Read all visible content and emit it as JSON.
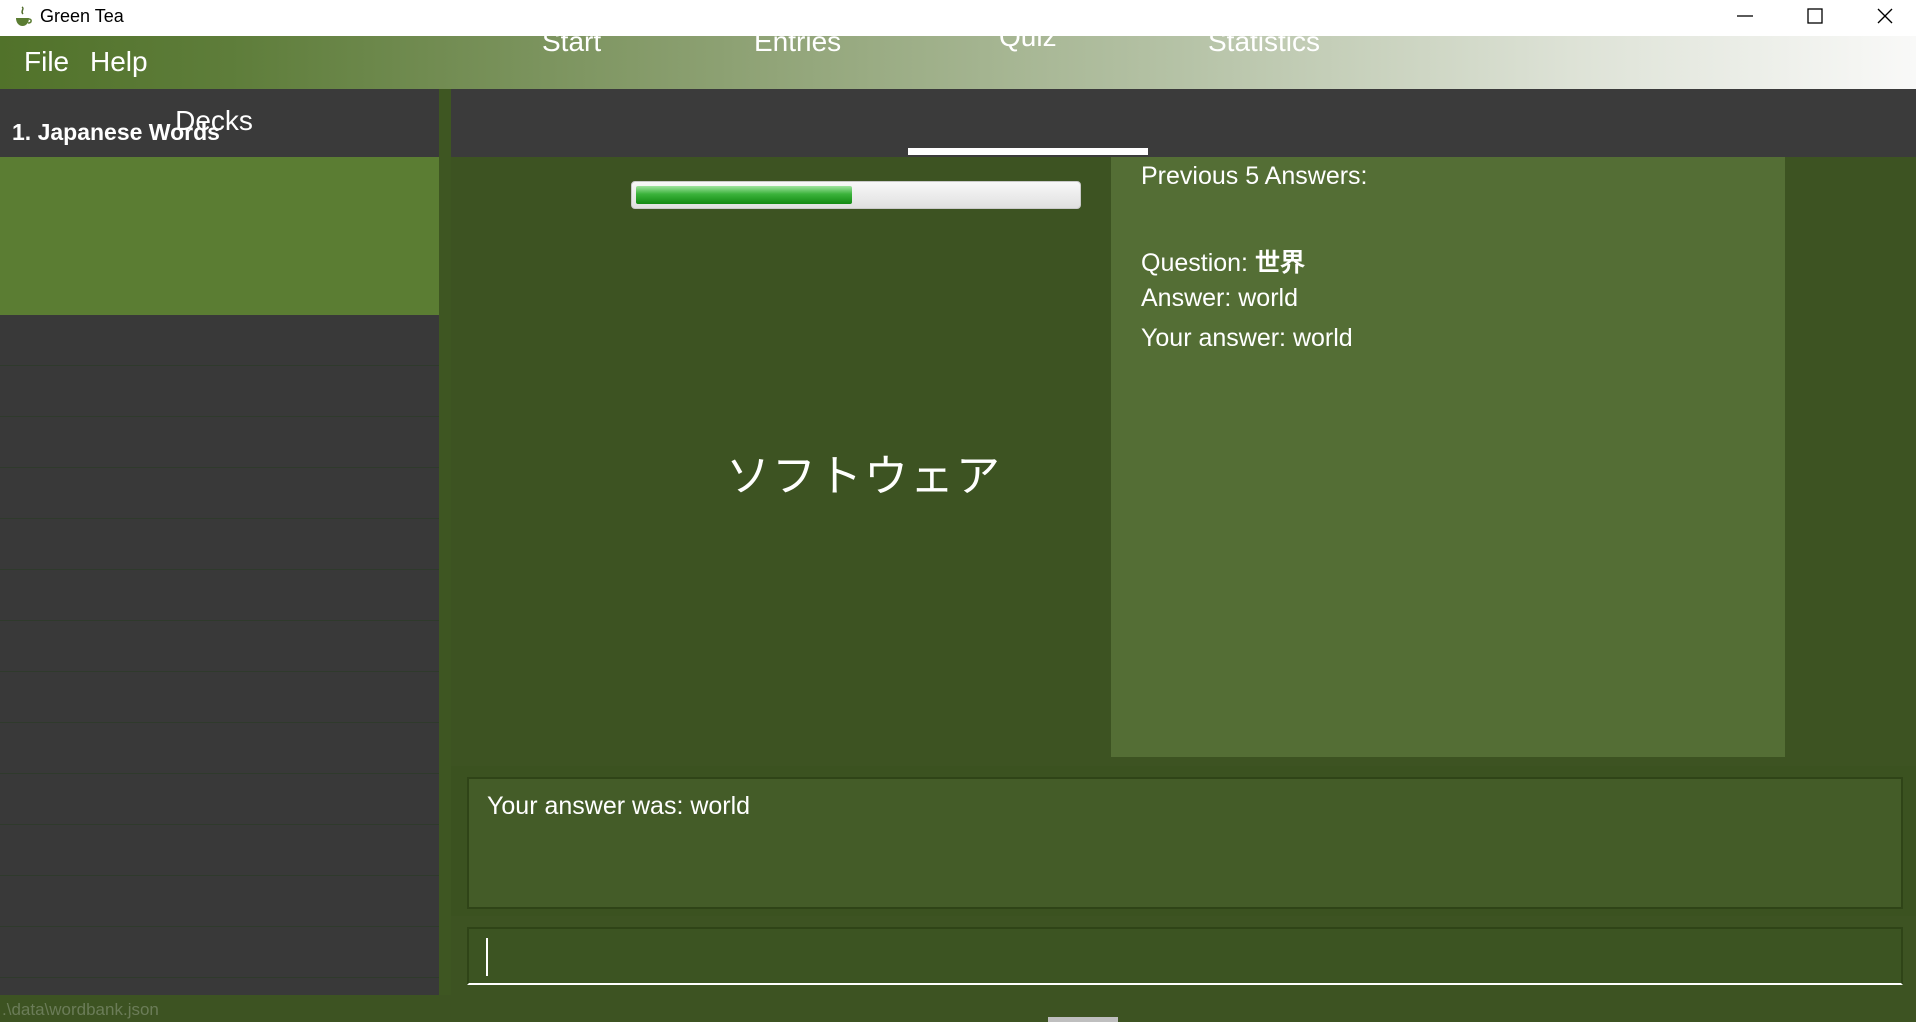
{
  "window": {
    "title": "Green Tea",
    "icon": "tea-cup-icon",
    "controls": [
      "minimize-icon",
      "maximize-icon",
      "close-icon"
    ]
  },
  "menu": {
    "items": [
      "File",
      "Help"
    ]
  },
  "sidebar": {
    "title": "Decks",
    "decks": [
      {
        "index": "1.",
        "name": "Japanese Words",
        "label": "1.  Japanese Words",
        "selected": true
      }
    ]
  },
  "tabs": {
    "items": [
      "Start",
      "Entries",
      "Quiz",
      "Statistics"
    ],
    "active": "Quiz"
  },
  "quiz": {
    "progress_fraction": 0.49,
    "question": "ソフトウェア"
  },
  "previous_answers": {
    "title": "Previous 5 Answers:",
    "question_label": "Question: ",
    "question_value": "世界",
    "answer_text": "Answer: world",
    "your_answer_text": "Your answer: world"
  },
  "result": {
    "text": "Your answer was: world"
  },
  "command_box": {
    "value": "",
    "placeholder": ""
  },
  "status": {
    "path": ".\\data\\wordbank.json"
  },
  "colors": {
    "accent_green": "#5b7d33",
    "panel_green": "#546e35",
    "background_green": "#3d5322",
    "sidebar_dark": "#3a3a3a"
  }
}
